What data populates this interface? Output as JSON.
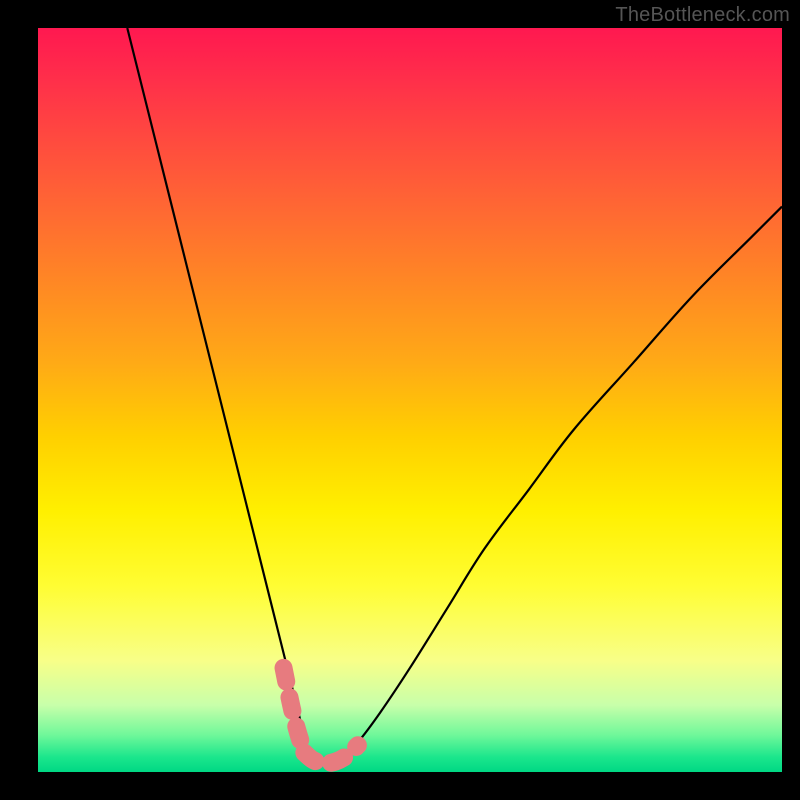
{
  "watermark": "TheBottleneck.com",
  "chart_data": {
    "type": "line",
    "title": "",
    "xlabel": "",
    "ylabel": "",
    "xlim": [
      0,
      100
    ],
    "ylim": [
      0,
      100
    ],
    "grid": false,
    "legend": false,
    "description": "Bottleneck curve chart: a V-shaped black curve over a vertical color gradient (red at top = bad, green at bottom = good). The valley of the curve marks the optimal balance point. Short pink dashed segments highlight the region right around the minimum.",
    "series": [
      {
        "name": "black-curve",
        "color": "#000000",
        "x": [
          12,
          14,
          16,
          18,
          20,
          22,
          24,
          26,
          28,
          30,
          32,
          34,
          35,
          36,
          37,
          38,
          39,
          41,
          43,
          46,
          50,
          55,
          60,
          66,
          72,
          80,
          88,
          96,
          100
        ],
        "y": [
          100,
          92,
          84,
          76,
          68,
          60,
          52,
          44,
          36,
          28,
          20,
          12,
          8,
          4,
          2,
          1,
          1,
          2,
          4,
          8,
          14,
          22,
          30,
          38,
          46,
          55,
          64,
          72,
          76
        ]
      },
      {
        "name": "pink-highlight-left",
        "color": "#e77b7f",
        "x": [
          33.0,
          33.6,
          34.2,
          34.8,
          35.4
        ],
        "y": [
          14.0,
          11.0,
          8.2,
          5.8,
          3.8
        ]
      },
      {
        "name": "pink-highlight-bottom",
        "color": "#e77b7f",
        "x": [
          35.8,
          37.0,
          38.5,
          40.0,
          41.5,
          43.0
        ],
        "y": [
          2.6,
          1.6,
          1.2,
          1.4,
          2.2,
          3.6
        ]
      }
    ],
    "gradient_stops": [
      {
        "pos": 0,
        "color": "#ff1850"
      },
      {
        "pos": 7,
        "color": "#ff2f4a"
      },
      {
        "pos": 15,
        "color": "#ff4a3f"
      },
      {
        "pos": 25,
        "color": "#ff6a32"
      },
      {
        "pos": 35,
        "color": "#ff8a23"
      },
      {
        "pos": 45,
        "color": "#ffaa16"
      },
      {
        "pos": 55,
        "color": "#ffd000"
      },
      {
        "pos": 65,
        "color": "#fff000"
      },
      {
        "pos": 75,
        "color": "#fffd33"
      },
      {
        "pos": 85,
        "color": "#f8ff88"
      },
      {
        "pos": 91,
        "color": "#c8ffaa"
      },
      {
        "pos": 95,
        "color": "#70f89a"
      },
      {
        "pos": 98,
        "color": "#1be68c"
      },
      {
        "pos": 100,
        "color": "#00d884"
      }
    ]
  }
}
